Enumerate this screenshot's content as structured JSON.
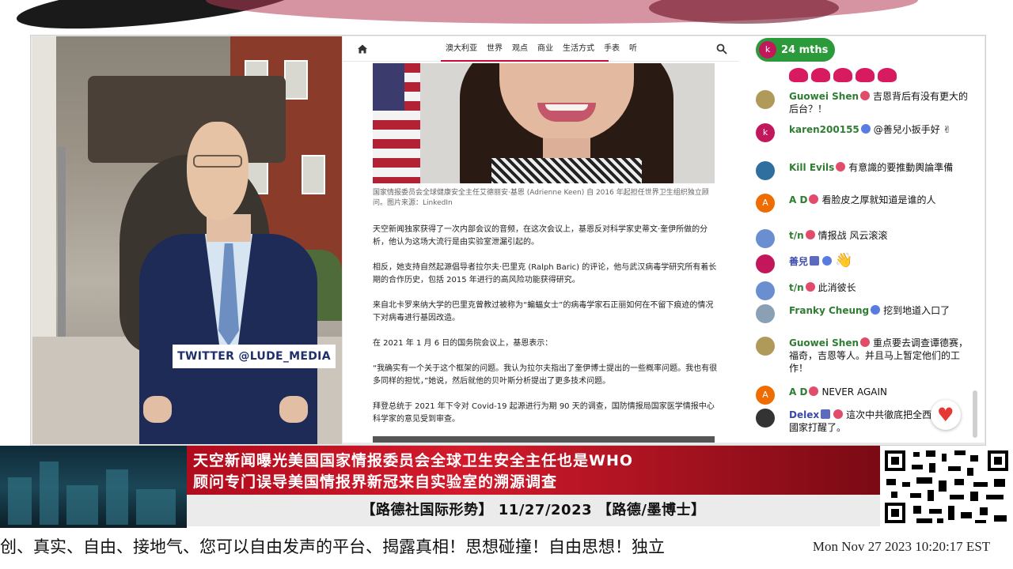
{
  "video": {
    "twitter_tag": "TWITTER  @LUDE_MEDIA"
  },
  "article": {
    "nav_items": [
      "澳大利亚",
      "世界",
      "观点",
      "商业",
      "生活方式",
      "手表",
      "听"
    ],
    "icons": {
      "home": "home-icon",
      "search": "search-icon"
    },
    "photo_caption": "国家情报委员会全球健康安全主任艾德丽安·基恩 (Adrienne Keen) 自 2016 年起担任世界卫生组织独立顾问。图片来源：LinkedIn",
    "paragraphs": [
      "天空新闻独家获得了一次内部会议的音频，在这次会议上，基恩反对科学家史蒂文·奎伊所做的分析，他认为这场大流行是由实验室泄漏引起的。",
      "相反，她支持自然起源倡导者拉尔夫·巴里克 (Ralph Baric) 的评论，他与武汉病毒学研究所有着长期的合作历史，包括 2015 年进行的高风险功能获得研究。",
      "来自北卡罗来纳大学的巴里克曾教过被称为“蝙蝠女士”的病毒学家石正丽如何在不留下痕迹的情况下对病毒进行基因改造。",
      "在 2021 年 1 月 6 日的国务院会议上，基恩表示：",
      "“我确实有一个关于这个框架的问题。我认为拉尔夫指出了奎伊博士提出的一些概率问题。我也有很多同样的担忧，”她说，然后就他的贝叶斯分析提出了更多技术问题。",
      "拜登总统于 2021 年下令对 Covid-19 起源进行为期 90 天的调查，国防情报局国家医学情报中心科学家的意见受到审查。"
    ]
  },
  "chat": {
    "member_avatar_letter": "k",
    "member_badge": "24 mths",
    "messages": [
      {
        "author": "Guowei Shen",
        "text": "吉恩背后有没有更大的后台？！",
        "avatar": "",
        "avatar_color": "#b09a5a",
        "mod": false
      },
      {
        "author": "karen200155",
        "text": "@善兒小扳手好 ✌",
        "avatar": "k",
        "avatar_color": "#c2185b",
        "mod": false
      },
      {
        "author": "Kill Evils",
        "text": "有意識的要推動輿論準備",
        "avatar": "",
        "avatar_color": "#2f6fa0",
        "mod": false
      },
      {
        "author": "A D",
        "text": "看脸皮之厚就知道是谁的人",
        "avatar": "A",
        "avatar_color": "#ef6c00",
        "mod": false
      },
      {
        "author": "t/n",
        "text": "情报战 风云滚滚",
        "avatar": "",
        "avatar_color": "#6a8fd0",
        "mod": false
      },
      {
        "author": "善兒",
        "text": "👋",
        "avatar": "",
        "avatar_color": "#c2185b",
        "mod": true
      },
      {
        "author": "t/n",
        "text": "此消彼长",
        "avatar": "",
        "avatar_color": "#6a8fd0",
        "mod": false
      },
      {
        "author": "Franky Cheung",
        "text": "挖到地道入口了",
        "avatar": "",
        "avatar_color": "#8aa0b5",
        "mod": false
      },
      {
        "author": "Guowei Shen",
        "text": "重点要去调查谭德赛，福奇，吉恩等人。并且马上暂定他们的工作！",
        "avatar": "",
        "avatar_color": "#b09a5a",
        "mod": false
      },
      {
        "author": "A D",
        "text": "NEVER AGAIN",
        "avatar": "A",
        "avatar_color": "#ef6c00",
        "mod": false
      },
      {
        "author": "Delex",
        "text": "這次中共徹底把全西方國家打醒了。",
        "avatar": "",
        "avatar_color": "#333333",
        "mod": true
      }
    ]
  },
  "banner": {
    "headline_line1": "天空新闻曝光美国国家情报委员会全球卫生安全主任也是WHO",
    "headline_line2": "顾问专门误导美国情报界新冠来自实验室的溯源调查",
    "subtitle": "【路德社国际形势】 11/27/2023 【路德/墨博士】"
  },
  "ticker": {
    "text": "创、真实、自由、接地气、您可以自由发声的平台、揭露真相！思想碰撞！自由思想！独立"
  },
  "clock": {
    "text": "Mon Nov 27 2023 10:20:17 EST"
  },
  "colors": {
    "headline_red": "#d21a2b",
    "member_green": "#2b9a3b",
    "nav_accent": "#c8102e",
    "twitter_text": "#1e2f6b"
  }
}
